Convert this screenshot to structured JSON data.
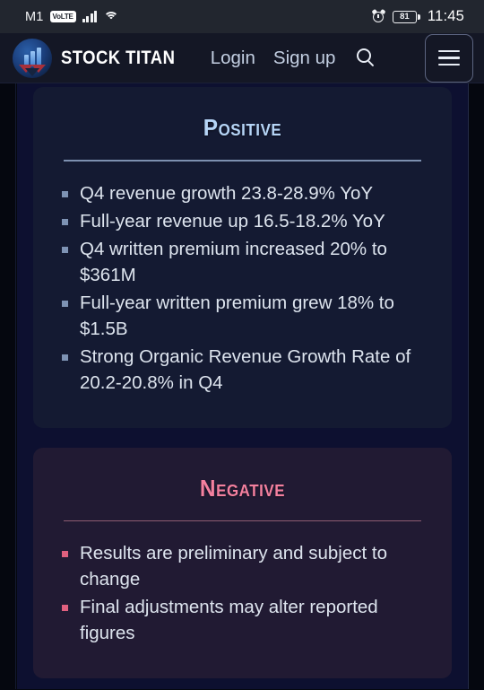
{
  "statusbar": {
    "carrier": "M1",
    "network_badge": "VoLTE",
    "signal_icon": "signal-bars-icon",
    "wifi_icon": "wifi-icon",
    "alarm_icon": "alarm-clock-icon",
    "battery_level": "81",
    "time": "11:45"
  },
  "header": {
    "logo_icon": "stock-titan-logo-icon",
    "brand": "STOCK TITAN",
    "login_label": "Login",
    "signup_label": "Sign up",
    "search_icon": "search-icon",
    "menu_icon": "hamburger-menu-icon"
  },
  "main": {
    "cards": [
      {
        "id": "positive",
        "title": "Positive",
        "accent": "#b6d5f7",
        "bullet_color": "#7e93b4",
        "background": "#141a32",
        "items": [
          "Q4 revenue growth 23.8-28.9% YoY",
          "Full-year revenue up 16.5-18.2% YoY",
          "Q4 written premium increased 20% to $361M",
          "Full-year written premium grew 18% to $1.5B",
          "Strong Organic Revenue Growth Rate of 20.2-20.8% in Q4"
        ]
      },
      {
        "id": "negative",
        "title": "Negative",
        "accent": "#f4809f",
        "bullet_color": "#e0607f",
        "background": "#211a33",
        "items": [
          "Results are preliminary and subject to change",
          "Final adjustments may alter reported figures"
        ]
      }
    ]
  }
}
